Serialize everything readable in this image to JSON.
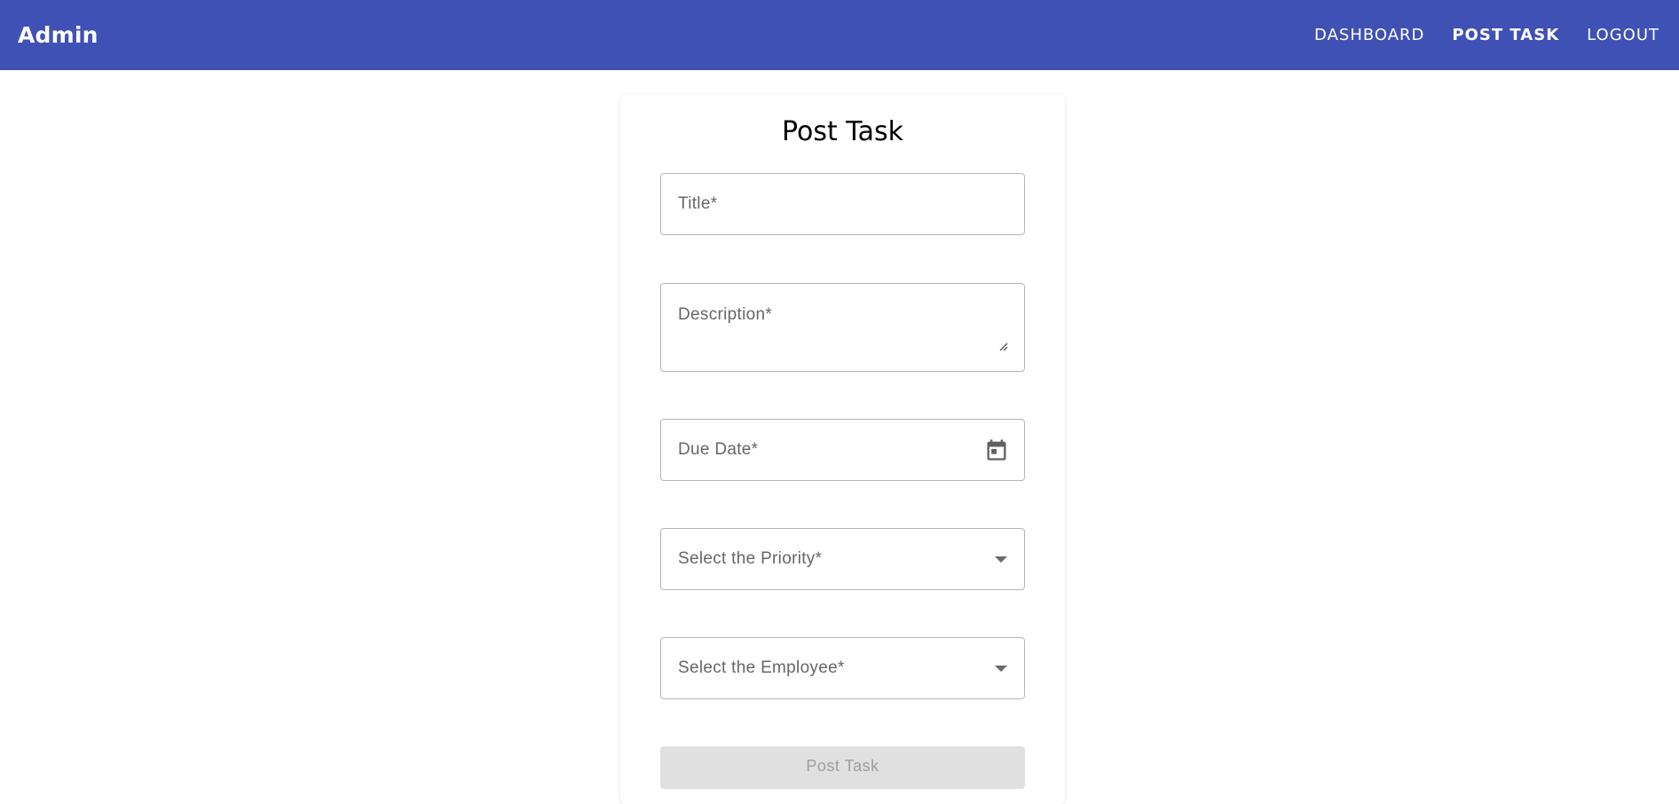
{
  "colors": {
    "brand": "#3f51b5"
  },
  "header": {
    "brand": "Admin",
    "nav": [
      {
        "label": "DASHBOARD"
      },
      {
        "label": "POST TASK"
      },
      {
        "label": "LOGOUT"
      }
    ]
  },
  "form": {
    "heading": "Post Task",
    "title_placeholder": "Title*",
    "description_placeholder": "Description*",
    "due_date_placeholder": "Due Date*",
    "priority_placeholder": "Select the Priority*",
    "employee_placeholder": "Select the Employee*",
    "submit_label": "Post Task",
    "icons": {
      "due_date": "calendar-icon",
      "dropdown": "chevron-down-icon",
      "textarea": "resize-handle-icon"
    }
  }
}
